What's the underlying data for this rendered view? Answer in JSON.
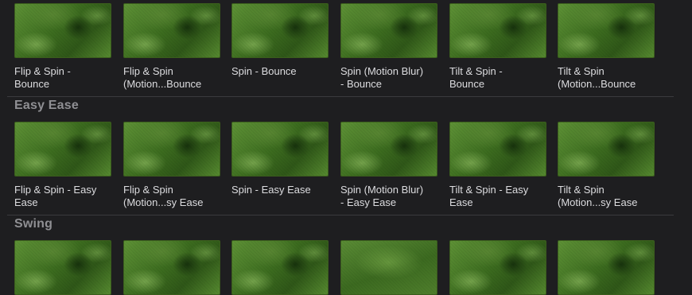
{
  "sections": [
    {
      "header": "",
      "items": [
        {
          "line1": "Flip & Spin -",
          "line2": "Bounce"
        },
        {
          "line1": "Flip & Spin",
          "line2": "(Motion...Bounce"
        },
        {
          "line1": "Spin - Bounce",
          "line2": ""
        },
        {
          "line1": "Spin (Motion Blur)",
          "line2": "- Bounce"
        },
        {
          "line1": "Tilt & Spin -",
          "line2": "Bounce"
        },
        {
          "line1": "Tilt & Spin",
          "line2": "(Motion...Bounce"
        }
      ]
    },
    {
      "header": "Easy Ease",
      "items": [
        {
          "line1": "Flip & Spin - Easy",
          "line2": "Ease"
        },
        {
          "line1": "Flip & Spin",
          "line2": "(Motion...sy Ease"
        },
        {
          "line1": "Spin - Easy Ease",
          "line2": ""
        },
        {
          "line1": "Spin (Motion Blur)",
          "line2": "- Easy Ease"
        },
        {
          "line1": "Tilt & Spin - Easy",
          "line2": "Ease"
        },
        {
          "line1": "Tilt & Spin",
          "line2": "(Motion...sy Ease"
        }
      ]
    },
    {
      "header": "Swing",
      "items": [
        {
          "line1": "",
          "line2": ""
        },
        {
          "line1": "",
          "line2": ""
        },
        {
          "line1": "",
          "line2": ""
        },
        {
          "line1": "",
          "line2": ""
        },
        {
          "line1": "",
          "line2": ""
        },
        {
          "line1": "",
          "line2": ""
        }
      ]
    }
  ]
}
